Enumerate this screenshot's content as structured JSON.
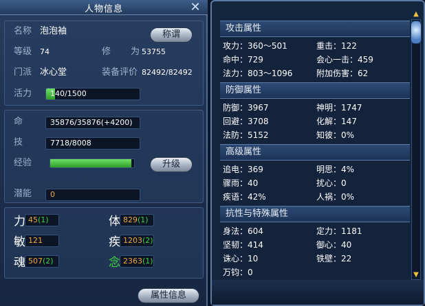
{
  "window": {
    "title": "人物信息",
    "close_symbol": "✕"
  },
  "info": {
    "name_label": "名称",
    "name_value": "泡泡袖",
    "title_button": "称谓",
    "level_label": "等级",
    "level_value": "74",
    "cultivation_label_1": "修",
    "cultivation_label_2": "为",
    "cultivation_value": "53755",
    "faction_label": "门派",
    "faction_value": "冰心堂",
    "gear_label": "装备评价",
    "gear_value": "82492/82492",
    "vitality_label": "活力",
    "vitality_value": "140/1500",
    "vitality_fraction": 0.093
  },
  "vitals": {
    "hp_label": "命",
    "hp_value": "35876/35876(+4200)",
    "skill_label": "技",
    "skill_value": "7718/8008",
    "exp_label": "经验",
    "exp_fraction": 0.97,
    "levelup_button": "升级",
    "potential_label": "潜能",
    "potential_value": "0"
  },
  "attributes": [
    {
      "label": "力",
      "value": "45",
      "bonus": "(1)"
    },
    {
      "label": "体",
      "value": "829",
      "bonus": "(1)"
    },
    {
      "label": "敏",
      "value": "121",
      "bonus": ""
    },
    {
      "label": "疾",
      "value": "1203",
      "bonus": "(2)"
    },
    {
      "label": "魂",
      "value": "507",
      "bonus": "(2)"
    },
    {
      "label": "念",
      "value": "2363",
      "bonus": "(1)"
    }
  ],
  "footer": {
    "attr_info_button": "属性信息"
  },
  "stats": {
    "attack": {
      "header": "攻击属性",
      "items": [
        {
          "label": "攻力：360～501"
        },
        {
          "label": "重击：122"
        },
        {
          "label": "命中：729"
        },
        {
          "label": "会心一击：459"
        },
        {
          "label": "法力：803～1096"
        },
        {
          "label": "附加伤害：62"
        }
      ]
    },
    "defense": {
      "header": "防御属性",
      "items": [
        {
          "label": "防御：3967"
        },
        {
          "label": "神明：1747"
        },
        {
          "label": "回避：3708"
        },
        {
          "label": "化解：147"
        },
        {
          "label": "法防：5152"
        },
        {
          "label": "知彼：0%"
        }
      ]
    },
    "advanced": {
      "header": "高级属性",
      "items": [
        {
          "label": "追电：369"
        },
        {
          "label": "明思：4%"
        },
        {
          "label": "骤雨：40"
        },
        {
          "label": "扰心：0"
        },
        {
          "label": "疾语：42%"
        },
        {
          "label": "人祸：0%"
        }
      ]
    },
    "resist": {
      "header": "抗性与特殊属性",
      "items": [
        {
          "label": "身法：604"
        },
        {
          "label": "定力：1181"
        },
        {
          "label": "坚韧：414"
        },
        {
          "label": "御心：40"
        },
        {
          "label": "诛心：10"
        },
        {
          "label": "铁壁：22"
        },
        {
          "label": "万钧：0"
        }
      ]
    }
  },
  "colors": {
    "accent_green": "#3bd23b",
    "value_orange": "#f0a640",
    "panel_blue": "#1e3150"
  }
}
